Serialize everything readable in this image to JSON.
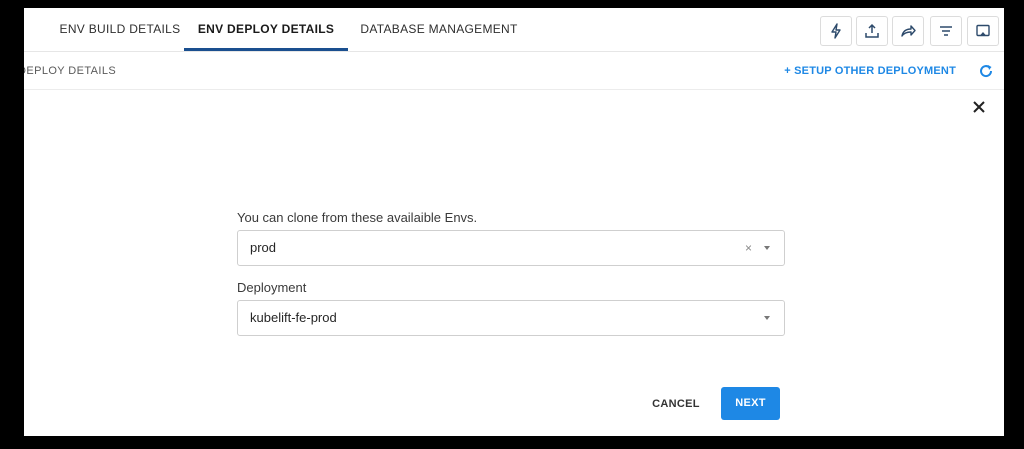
{
  "tabs": [
    {
      "label": "ENV BUILD DETAILS"
    },
    {
      "label": "ENV DEPLOY DETAILS"
    },
    {
      "label": "DATABASE MANAGEMENT"
    }
  ],
  "active_tab": "ENV DEPLOY DETAILS",
  "toolbar_icons": [
    "lightning-icon",
    "upload-icon",
    "share-icon",
    "filter-icon",
    "cast-icon"
  ],
  "subheader": {
    "breadcrumb": "DEPLOY DETAILS",
    "setup_link": "+ SETUP OTHER DEPLOYMENT"
  },
  "form": {
    "env_label": "You can clone from these availaible Envs.",
    "env_value": "prod",
    "env_clear": "×",
    "deployment_label": "Deployment",
    "deployment_value": "kubelift-fe-prod"
  },
  "actions": {
    "cancel": "CANCEL",
    "next": "NEXT"
  },
  "colors": {
    "accent": "#1e88e5",
    "tab_indicator": "#1a4f8f",
    "text": "#2e2e2e"
  }
}
